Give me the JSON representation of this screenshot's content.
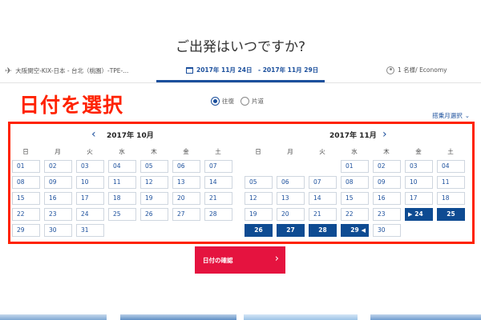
{
  "page": {
    "title": "ご出発はいつですか?"
  },
  "tabs": {
    "route": "大阪関空-KIX-日本 - 台北（桃園）-TPE-...",
    "dates": "2017年 11月 24日　- 2017年 11月 29日",
    "passengers": "1 名様/ Economy"
  },
  "annotation": {
    "label": "日付を選択",
    "color": "#ff2200"
  },
  "trip_type": {
    "round_trip": "往復",
    "one_way": "片道",
    "selected": "往復"
  },
  "month_select": {
    "label": "搭乗月選択",
    "icon": "chevron-down-icon"
  },
  "weekdays": [
    "日",
    "月",
    "火",
    "水",
    "木",
    "金",
    "土"
  ],
  "calendars": [
    {
      "month_label": "2017年 10月",
      "nav_icon": "chevron-left-icon",
      "weeks": [
        [
          "01",
          "02",
          "03",
          "04",
          "05",
          "06",
          "07"
        ],
        [
          "08",
          "09",
          "10",
          "11",
          "12",
          "13",
          "14"
        ],
        [
          "15",
          "16",
          "17",
          "18",
          "19",
          "20",
          "21"
        ],
        [
          "22",
          "23",
          "24",
          "25",
          "26",
          "27",
          "28"
        ],
        [
          "29",
          "30",
          "31",
          "",
          "",
          "",
          ""
        ]
      ],
      "selected": []
    },
    {
      "month_label": "2017年 11月",
      "nav_icon": "chevron-right-icon",
      "weeks": [
        [
          "",
          "",
          "",
          "01",
          "02",
          "03",
          "04"
        ],
        [
          "05",
          "06",
          "07",
          "08",
          "09",
          "10",
          "11"
        ],
        [
          "12",
          "13",
          "14",
          "15",
          "16",
          "17",
          "18"
        ],
        [
          "19",
          "20",
          "21",
          "22",
          "23",
          "24",
          "25"
        ],
        [
          "26",
          "27",
          "28",
          "29",
          "30",
          "",
          ""
        ]
      ],
      "selected": [
        "24",
        "25",
        "26",
        "27",
        "28",
        "29"
      ],
      "range_start": "24",
      "range_end": "29"
    }
  ],
  "confirm": {
    "label": "日付の確認",
    "color": "#e5133f"
  },
  "colors": {
    "accent": "#1b4f9c",
    "selected_day": "#0e4b92"
  }
}
